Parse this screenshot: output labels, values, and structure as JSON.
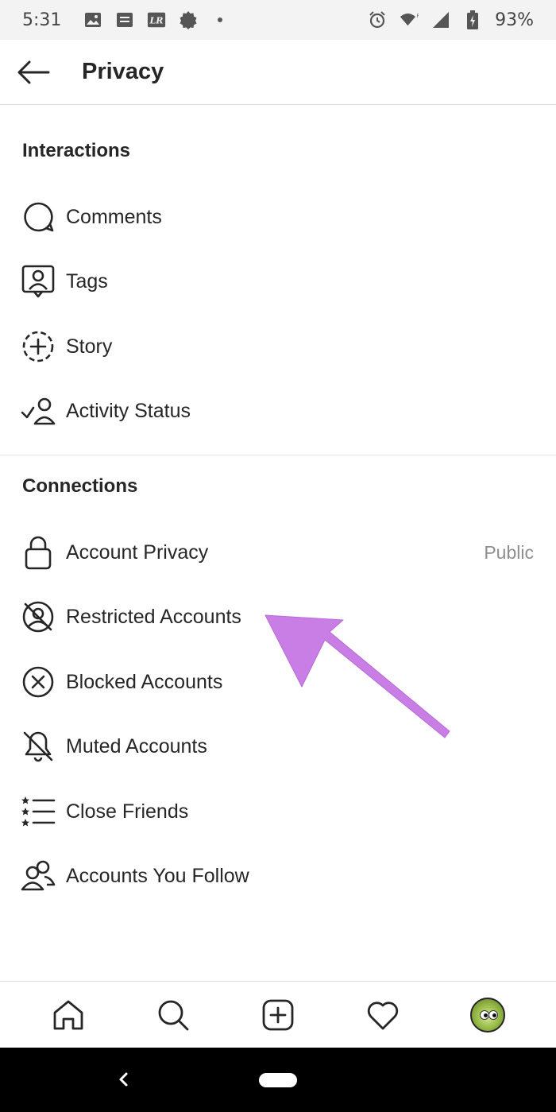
{
  "status_bar": {
    "time": "5:31",
    "battery_percent": "93%",
    "left_icons": [
      "image-icon",
      "message-icon",
      "lr-icon",
      "badge-icon",
      "dot-icon"
    ],
    "right_icons": [
      "alarm-icon",
      "wifi-icon",
      "signal-icon",
      "battery-icon"
    ],
    "lr_text": "LR"
  },
  "header": {
    "title": "Privacy",
    "back_icon": "arrow-left-icon"
  },
  "sections": {
    "interactions": {
      "title": "Interactions",
      "items": [
        {
          "label": "Comments",
          "icon": "comment-icon"
        },
        {
          "label": "Tags",
          "icon": "tag-person-icon"
        },
        {
          "label": "Story",
          "icon": "story-add-icon"
        },
        {
          "label": "Activity Status",
          "icon": "activity-status-icon"
        }
      ]
    },
    "connections": {
      "title": "Connections",
      "items": [
        {
          "label": "Account Privacy",
          "icon": "lock-icon",
          "value": "Public"
        },
        {
          "label": "Restricted Accounts",
          "icon": "restricted-icon"
        },
        {
          "label": "Blocked Accounts",
          "icon": "blocked-icon"
        },
        {
          "label": "Muted Accounts",
          "icon": "muted-bell-icon"
        },
        {
          "label": "Close Friends",
          "icon": "close-friends-icon"
        },
        {
          "label": "Accounts You Follow",
          "icon": "following-icon"
        }
      ]
    }
  },
  "annotation": {
    "arrow_color": "#c97ee6",
    "points_to": "Restricted Accounts"
  },
  "bottom_nav": {
    "items": [
      "home-icon",
      "search-icon",
      "new-post-icon",
      "activity-heart-icon",
      "profile-avatar"
    ]
  },
  "colors": {
    "text": "#262626",
    "secondary_text": "#8e8e8e",
    "divider": "#dbdbdb",
    "status_bar_bg": "#f3f3f3",
    "system_nav_bg": "#000000"
  }
}
